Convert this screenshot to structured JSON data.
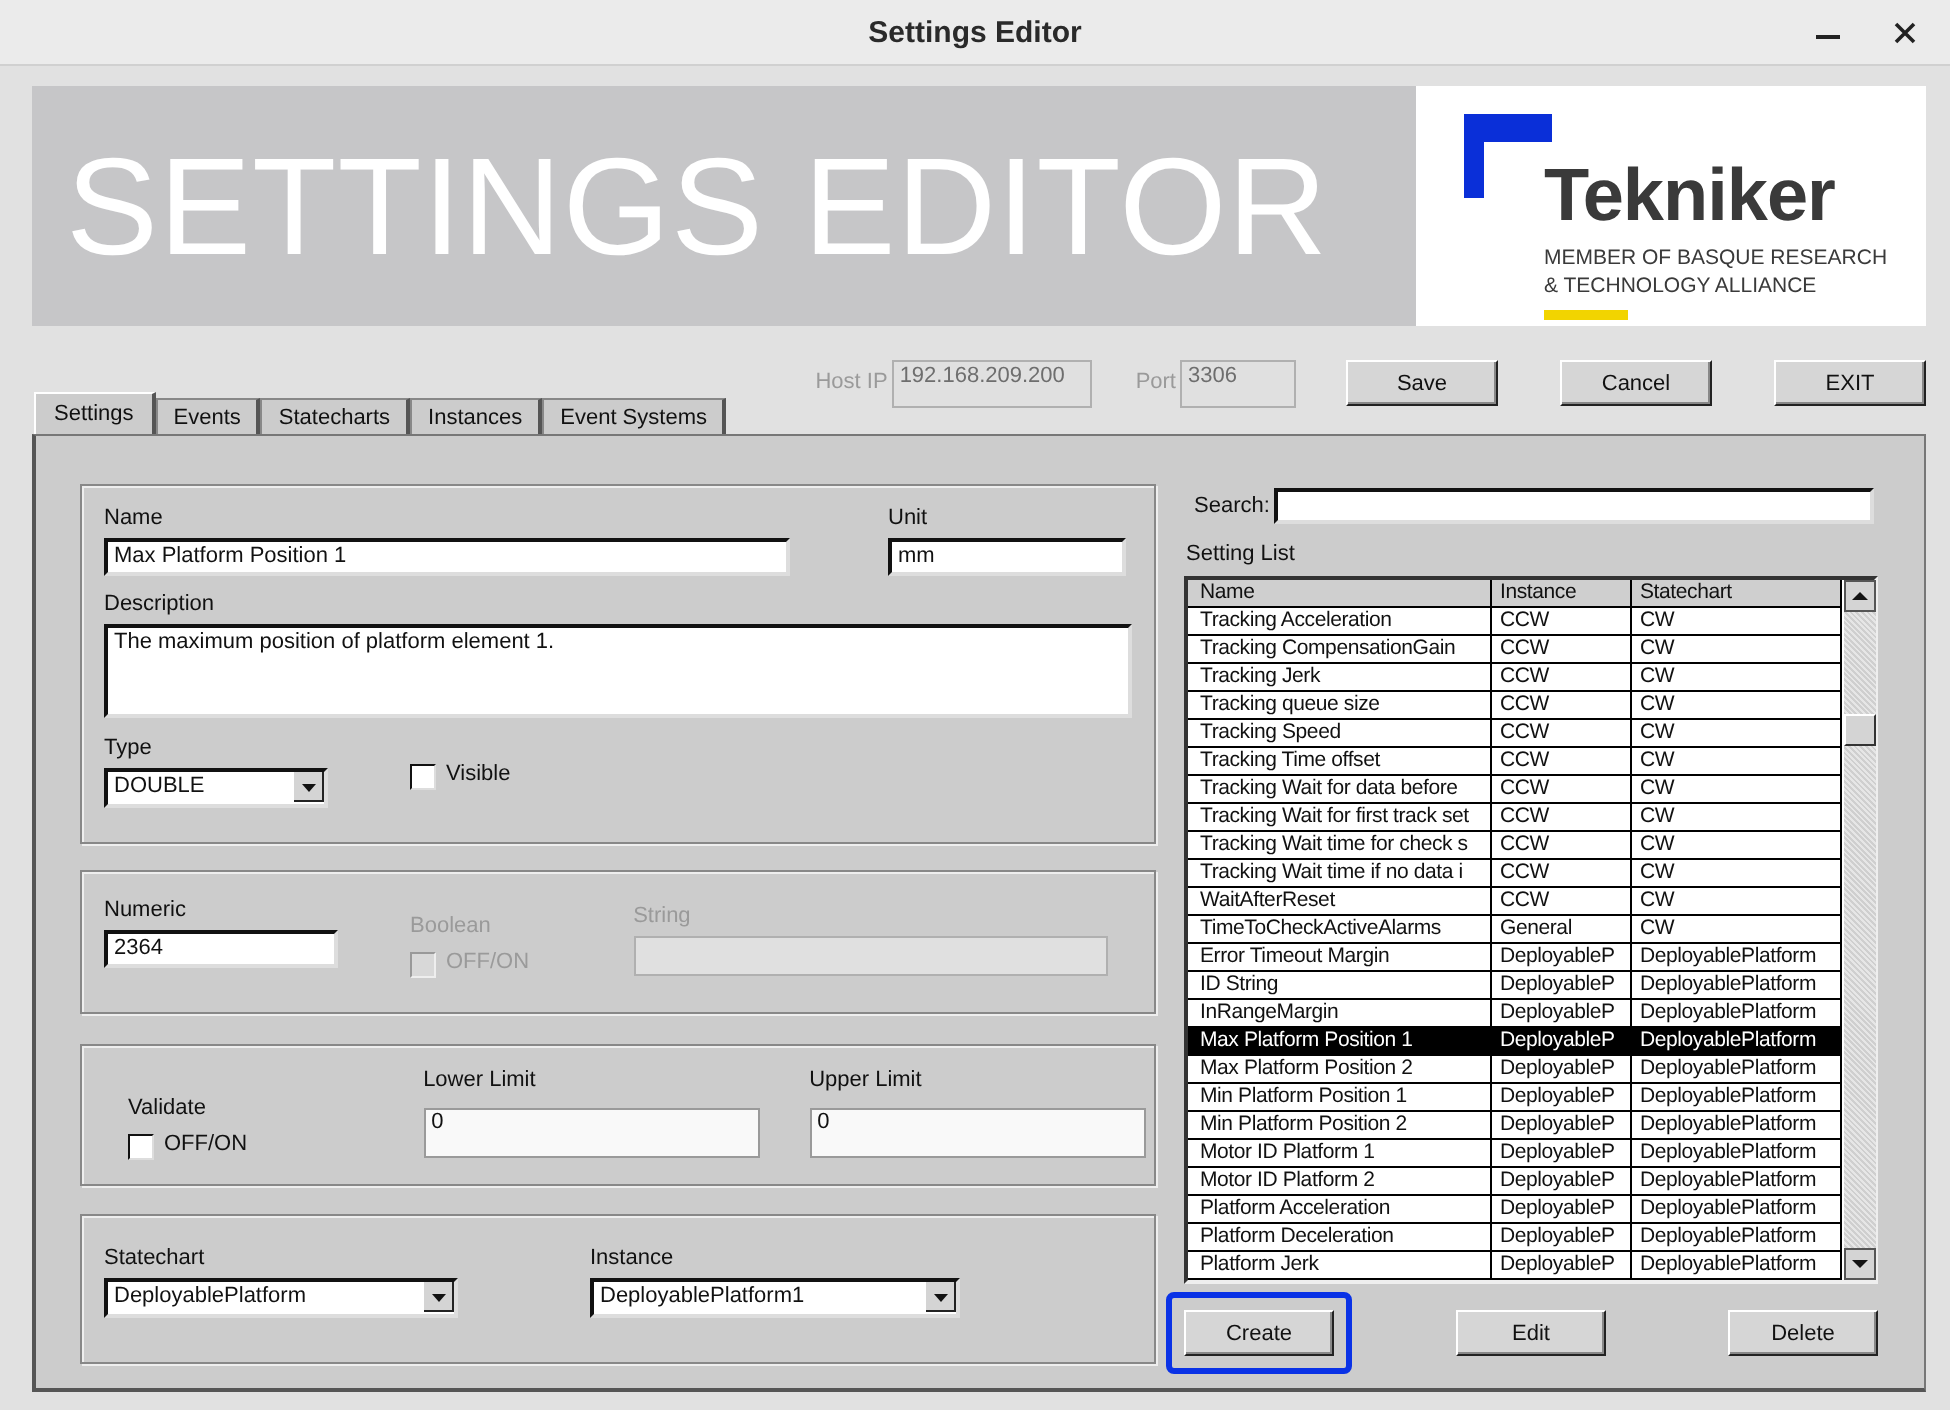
{
  "window": {
    "title": "Settings Editor"
  },
  "banner": {
    "title": "SETTINGS EDITOR",
    "logo": {
      "name": "Tekniker",
      "tagline": [
        "MEMBER OF BASQUE RESEARCH",
        "& TECHNOLOGY ALLIANCE"
      ]
    }
  },
  "connection": {
    "host_ip": {
      "label": "Host IP",
      "value": "192.168.209.200",
      "disabled": true
    },
    "port": {
      "label": "Port",
      "value": "3306",
      "disabled": true
    }
  },
  "top_buttons": [
    "Save",
    "Cancel",
    "EXIT"
  ],
  "tabs": [
    {
      "label": "Settings",
      "selected": true
    },
    {
      "label": "Events",
      "selected": false
    },
    {
      "label": "Statecharts",
      "selected": false
    },
    {
      "label": "Instances",
      "selected": false
    },
    {
      "label": "Event Systems",
      "selected": false
    }
  ],
  "setting_form": {
    "name": {
      "label": "Name",
      "value": "Max Platform Position 1"
    },
    "unit": {
      "label": "Unit",
      "value": "mm"
    },
    "description": {
      "label": "Description",
      "value": "The maximum position of platform element 1."
    },
    "type": {
      "label": "Type",
      "value": "DOUBLE"
    },
    "visible": {
      "label": "Visible",
      "checked": false
    },
    "numeric": {
      "label": "Numeric",
      "value": "2364",
      "disabled": false
    },
    "boolean": {
      "label": "Boolean",
      "option": "OFF/ON",
      "checked": false,
      "disabled": true
    },
    "string": {
      "label": "String",
      "disabled": true
    },
    "validate": {
      "label": "Validate",
      "option": "OFF/ON",
      "checked": false
    },
    "lower_limit": {
      "label": "Lower Limit",
      "value": "0"
    },
    "upper_limit": {
      "label": "Upper Limit",
      "value": "0"
    },
    "statechart": {
      "label": "Statechart",
      "value": "DeployablePlatform"
    },
    "instance": {
      "label": "Instance",
      "value": "DeployablePlatform1"
    }
  },
  "setting_list": {
    "search_label": "Search:",
    "title": "Setting List",
    "columns": [
      "Name",
      "Instance",
      "Statechart"
    ],
    "rows": [
      {
        "cells": [
          "Tracking Acceleration",
          "CCW",
          "CW"
        ],
        "selected": false
      },
      {
        "cells": [
          "Tracking CompensationGain",
          "CCW",
          "CW"
        ],
        "selected": false
      },
      {
        "cells": [
          "Tracking Jerk",
          "CCW",
          "CW"
        ],
        "selected": false
      },
      {
        "cells": [
          "Tracking queue size",
          "CCW",
          "CW"
        ],
        "selected": false
      },
      {
        "cells": [
          "Tracking Speed",
          "CCW",
          "CW"
        ],
        "selected": false
      },
      {
        "cells": [
          "Tracking Time offset",
          "CCW",
          "CW"
        ],
        "selected": false
      },
      {
        "cells": [
          "Tracking Wait for data before",
          "CCW",
          "CW"
        ],
        "selected": false
      },
      {
        "cells": [
          "Tracking Wait for first track set",
          "CCW",
          "CW"
        ],
        "selected": false
      },
      {
        "cells": [
          "Tracking Wait time for check s",
          "CCW",
          "CW"
        ],
        "selected": false
      },
      {
        "cells": [
          "Tracking Wait time if no data i",
          "CCW",
          "CW"
        ],
        "selected": false
      },
      {
        "cells": [
          "WaitAfterReset",
          "CCW",
          "CW"
        ],
        "selected": false
      },
      {
        "cells": [
          "TimeToCheckActiveAlarms",
          "General",
          "CW"
        ],
        "selected": false
      },
      {
        "cells": [
          "Error Timeout Margin",
          "DeployableP",
          "DeployablePlatform"
        ],
        "selected": false
      },
      {
        "cells": [
          "ID String",
          "DeployableP",
          "DeployablePlatform"
        ],
        "selected": false
      },
      {
        "cells": [
          "InRangeMargin",
          "DeployableP",
          "DeployablePlatform"
        ],
        "selected": false
      },
      {
        "cells": [
          "Max Platform Position 1",
          "DeployableP",
          "DeployablePlatform"
        ],
        "selected": true
      },
      {
        "cells": [
          "Max Platform Position 2",
          "DeployableP",
          "DeployablePlatform"
        ],
        "selected": false
      },
      {
        "cells": [
          "Min Platform Position 1",
          "DeployableP",
          "DeployablePlatform"
        ],
        "selected": false
      },
      {
        "cells": [
          "Min Platform Position 2",
          "DeployableP",
          "DeployablePlatform"
        ],
        "selected": false
      },
      {
        "cells": [
          "Motor ID Platform 1",
          "DeployableP",
          "DeployablePlatform"
        ],
        "selected": false
      },
      {
        "cells": [
          "Motor ID Platform 2",
          "DeployableP",
          "DeployablePlatform"
        ],
        "selected": false
      },
      {
        "cells": [
          "Platform Acceleration",
          "DeployableP",
          "DeployablePlatform"
        ],
        "selected": false
      },
      {
        "cells": [
          "Platform Deceleration",
          "DeployableP",
          "DeployablePlatform"
        ],
        "selected": false
      },
      {
        "cells": [
          "Platform Jerk",
          "DeployableP",
          "DeployablePlatform"
        ],
        "selected": false
      }
    ]
  },
  "list_buttons": [
    {
      "label": "Create",
      "focused": true
    },
    {
      "label": "Edit",
      "focused": false
    },
    {
      "label": "Delete",
      "focused": false
    }
  ]
}
